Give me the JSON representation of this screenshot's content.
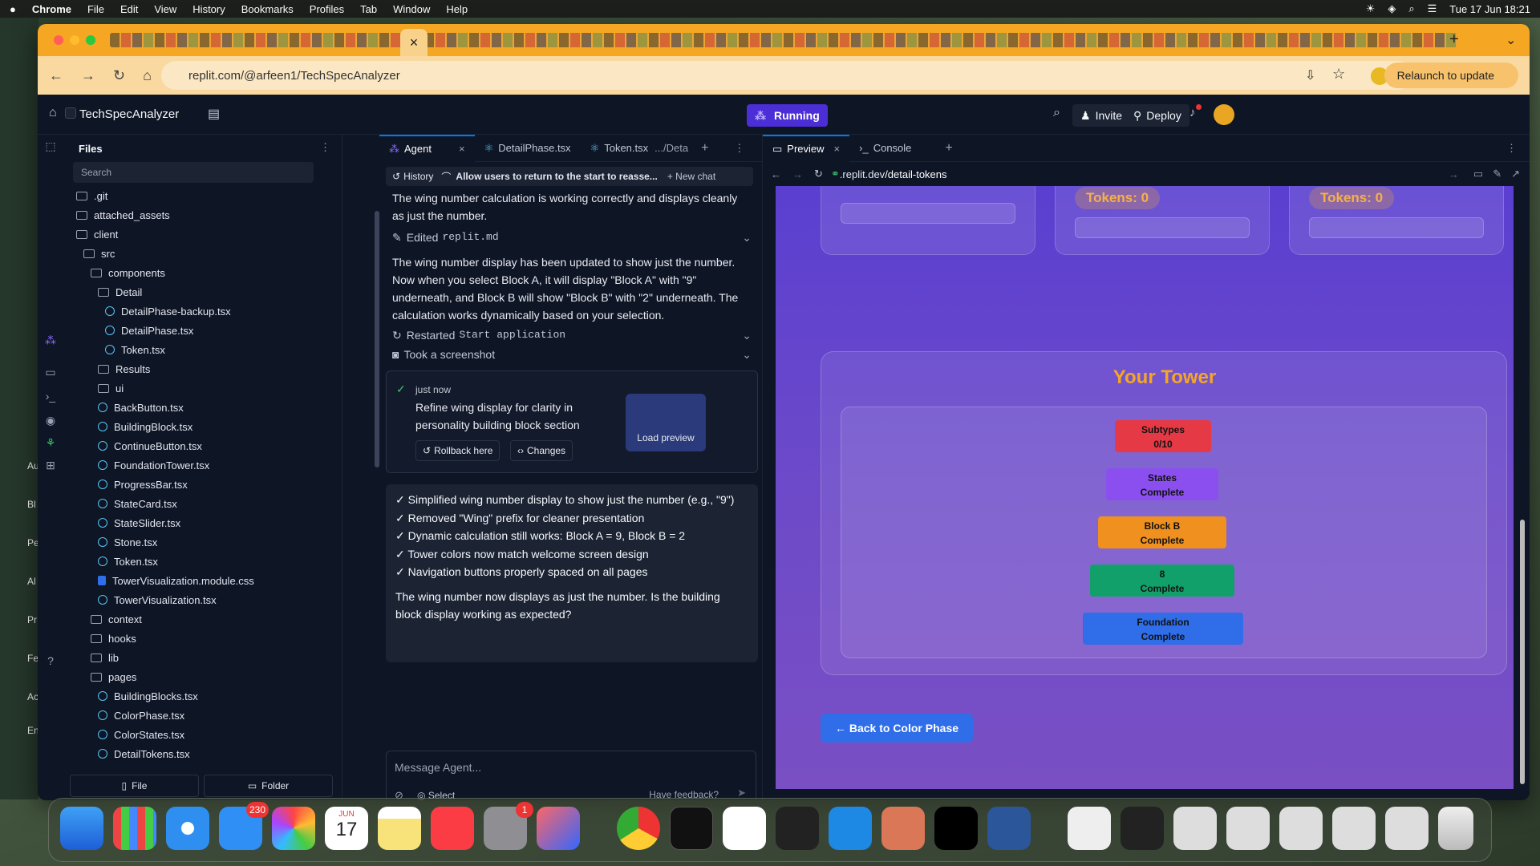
{
  "menubar": {
    "apple": "",
    "items": [
      "Chrome",
      "File",
      "Edit",
      "View",
      "History",
      "Bookmarks",
      "Profiles",
      "Tab",
      "Window",
      "Help"
    ],
    "clock": "Tue 17 Jun  18:21"
  },
  "desktop_strip": [
    "Au",
    "Bl",
    "Pe",
    "Al",
    "Pr",
    "Fe",
    "Ac",
    "En"
  ],
  "browser": {
    "url": "replit.com/@arfeen1/TechSpecAnalyzer",
    "relaunch": "Relaunch to update"
  },
  "replit": {
    "project": "TechSpecAnalyzer",
    "running": "Running",
    "invite": "Invite",
    "deploy": "Deploy"
  },
  "files": {
    "title": "Files",
    "search_placeholder": "Search",
    "tree": [
      {
        "name": ".git",
        "type": "fold",
        "d": 0
      },
      {
        "name": "attached_assets",
        "type": "fold",
        "d": 0
      },
      {
        "name": "client",
        "type": "fold",
        "d": 0
      },
      {
        "name": "src",
        "type": "fold",
        "d": 1
      },
      {
        "name": "components",
        "type": "fold",
        "d": 2
      },
      {
        "name": "Detail",
        "type": "fold",
        "d": 3
      },
      {
        "name": "DetailPhase-backup.tsx",
        "type": "react",
        "d": 4
      },
      {
        "name": "DetailPhase.tsx",
        "type": "react",
        "d": 4
      },
      {
        "name": "Token.tsx",
        "type": "react",
        "d": 4
      },
      {
        "name": "Results",
        "type": "fold",
        "d": 3
      },
      {
        "name": "ui",
        "type": "fold",
        "d": 3
      },
      {
        "name": "BackButton.tsx",
        "type": "react",
        "d": 3
      },
      {
        "name": "BuildingBlock.tsx",
        "type": "react",
        "d": 3
      },
      {
        "name": "ContinueButton.tsx",
        "type": "react",
        "d": 3
      },
      {
        "name": "FoundationTower.tsx",
        "type": "react",
        "d": 3
      },
      {
        "name": "ProgressBar.tsx",
        "type": "react",
        "d": 3
      },
      {
        "name": "StateCard.tsx",
        "type": "react",
        "d": 3
      },
      {
        "name": "StateSlider.tsx",
        "type": "react",
        "d": 3
      },
      {
        "name": "Stone.tsx",
        "type": "react",
        "d": 3
      },
      {
        "name": "Token.tsx",
        "type": "react",
        "d": 3
      },
      {
        "name": "TowerVisualization.module.css",
        "type": "css",
        "d": 3
      },
      {
        "name": "TowerVisualization.tsx",
        "type": "react",
        "d": 3
      },
      {
        "name": "context",
        "type": "fold",
        "d": 2
      },
      {
        "name": "hooks",
        "type": "fold",
        "d": 2
      },
      {
        "name": "lib",
        "type": "fold",
        "d": 2
      },
      {
        "name": "pages",
        "type": "fold",
        "d": 2
      },
      {
        "name": "BuildingBlocks.tsx",
        "type": "react",
        "d": 3
      },
      {
        "name": "ColorPhase.tsx",
        "type": "react",
        "d": 3
      },
      {
        "name": "ColorStates.tsx",
        "type": "react",
        "d": 3
      },
      {
        "name": "DetailTokens.tsx",
        "type": "react",
        "d": 3
      }
    ],
    "new_file": "File",
    "new_folder": "Folder"
  },
  "agent": {
    "tabs": [
      "Agent",
      "DetailPhase.tsx",
      "Token.tsx",
      ".../Deta"
    ],
    "history": "History",
    "thread": "Allow users to return to the start to reasse...",
    "new_chat": "New chat",
    "msg1": "The wing number calculation is working correctly and displays cleanly as just the number.",
    "ev_edit": "Edited",
    "ev_edit_file": "replit.md",
    "msg2": "The wing number display has been updated to show just the number. Now when you select Block A, it will display \"Block A\" with \"9\" underneath, and Block B will show \"Block B\" with \"2\" underneath. The calculation works dynamically based on your selection.",
    "ev_restart": "Restarted",
    "ev_restart_cmd": "Start application",
    "ev_shot": "Took a screenshot",
    "checkpoint": {
      "when": "just now",
      "text": "Refine wing display for clarity in personality building block section",
      "load": "Load preview",
      "rollback": "Rollback here",
      "changes": "Changes"
    },
    "summary": [
      "✓ Simplified wing number display to show just the number (e.g., \"9\")",
      "✓ Removed \"Wing\" prefix for cleaner presentation",
      "✓ Dynamic calculation still works: Block A = 9, Block B = 2",
      "✓ Tower colors now match welcome screen design",
      "✓ Navigation buttons properly spaced on all pages"
    ],
    "question": "The wing number now displays as just the number. Is the building block display working as expected?",
    "input_placeholder": "Message Agent...",
    "select": "Select",
    "feedback": "Have feedback?"
  },
  "preview": {
    "tabs": [
      "Preview",
      "Console"
    ],
    "url_host": ".replit.dev",
    "url_path": "/detail-tokens",
    "tokens": [
      "Tokens: 0",
      "Tokens: 0"
    ],
    "tower_title": "Your Tower",
    "blocks": [
      {
        "l1": "Subtypes",
        "l2": "0/10",
        "color": "#e63946"
      },
      {
        "l1": "States",
        "l2": "Complete",
        "color": "#8b4ff0"
      },
      {
        "l1": "Block B",
        "l2": "Complete",
        "color": "#f0901e"
      },
      {
        "l1": "8",
        "l2": "Complete",
        "color": "#12a06a"
      },
      {
        "l1": "Foundation",
        "l2": "Complete",
        "color": "#2f6ee8"
      }
    ],
    "back": "← Back to Color Phase"
  },
  "dock": {
    "mail_badge": "230",
    "settings_badge": "1",
    "calendar_month": "JUN",
    "calendar_day": "17"
  }
}
